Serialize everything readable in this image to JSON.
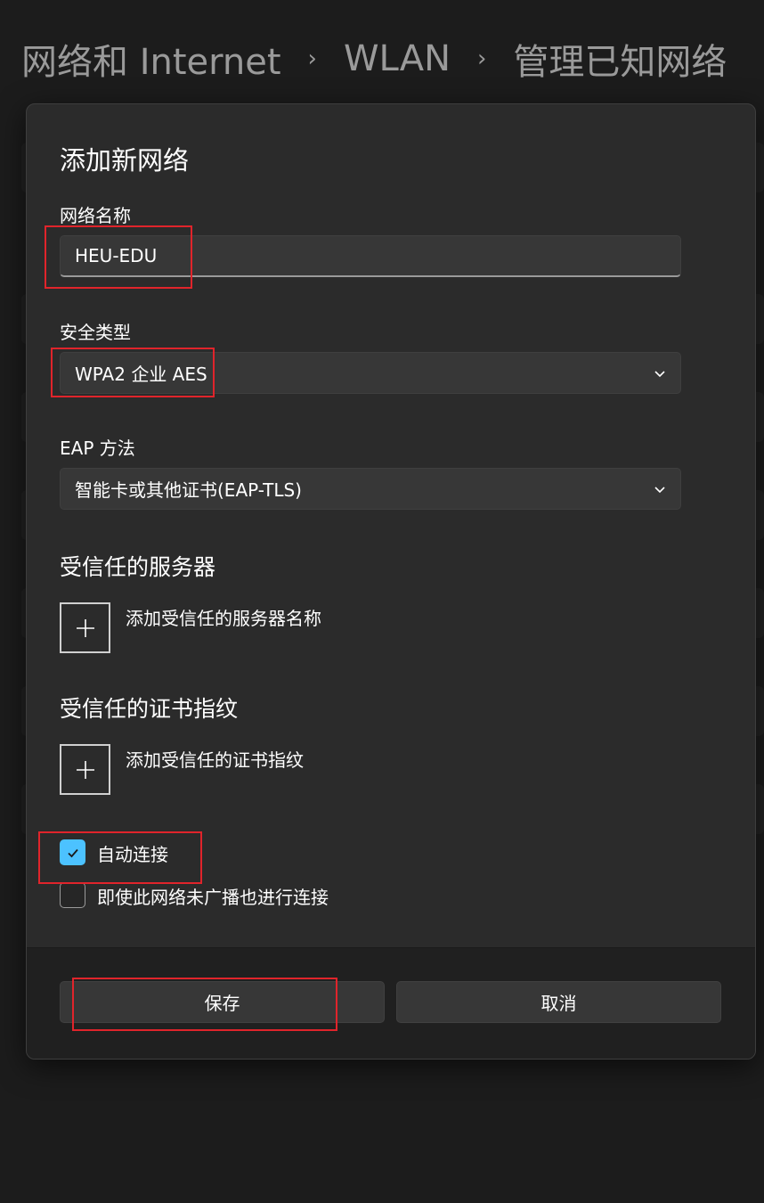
{
  "breadcrumb": {
    "items": [
      "网络和 Internet",
      "WLAN",
      "管理已知网络"
    ],
    "separator": "›"
  },
  "dialog": {
    "title": "添加新网络",
    "network_name": {
      "label": "网络名称",
      "value": "HEU-EDU"
    },
    "security_type": {
      "label": "安全类型",
      "value": "WPA2 企业 AES"
    },
    "eap_method": {
      "label": "EAP 方法",
      "value": "智能卡或其他证书(EAP-TLS)"
    },
    "trusted_servers": {
      "title": "受信任的服务器",
      "add_label": "添加受信任的服务器名称"
    },
    "trusted_fingerprints": {
      "title": "受信任的证书指纹",
      "add_label": "添加受信任的证书指纹"
    },
    "auto_connect": {
      "label": "自动连接",
      "checked": true
    },
    "connect_hidden": {
      "label": "即使此网络未广播也进行连接",
      "checked": false
    },
    "save_label": "保存",
    "cancel_label": "取消"
  },
  "colors": {
    "background": "#1c1c1c",
    "dialog": "#2b2b2b",
    "accent": "#4cc2ff",
    "highlight": "#e0242b"
  },
  "icons": [
    "chevron-right-icon",
    "chevron-down-icon",
    "plus-icon",
    "checkmark-icon"
  ]
}
